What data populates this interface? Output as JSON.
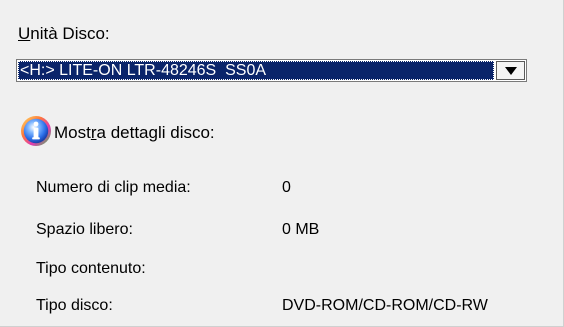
{
  "drive": {
    "label_mnemonic": "U",
    "label_rest": "nità Disco:",
    "selected": "<H:> LITE-ON LTR-48246S  SS0A"
  },
  "details": {
    "icon": "info-icon",
    "label_before": "Most",
    "label_mnemonic": "r",
    "label_after": "a dettagli disco:"
  },
  "info_rows": [
    {
      "key": "Numero di clip media:",
      "value": "0"
    },
    {
      "key": "Spazio libero:",
      "value": "0 MB"
    },
    {
      "key": "Tipo contenuto:",
      "value": ""
    },
    {
      "key": "Tipo disco:",
      "value": "DVD-ROM/CD-ROM/CD-RW"
    }
  ],
  "colors": {
    "panel_bg": "#f0f0f0",
    "selection_bg": "#0a246a",
    "selection_text": "#ffffff"
  }
}
